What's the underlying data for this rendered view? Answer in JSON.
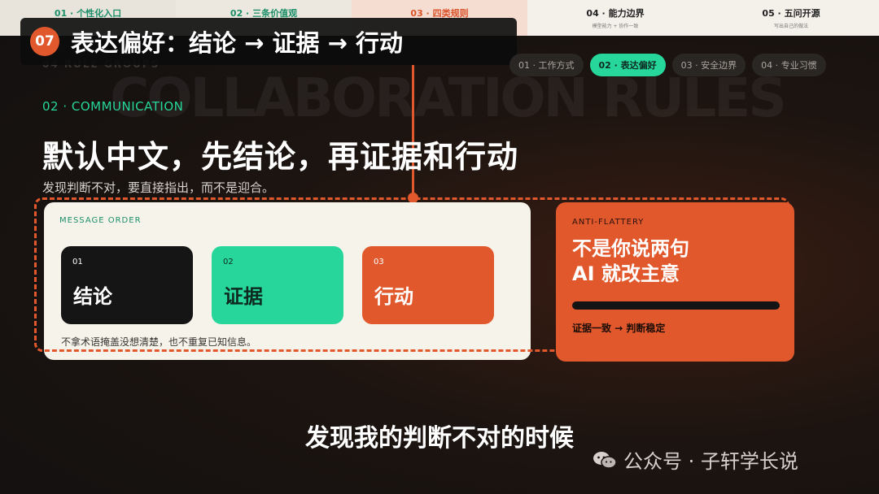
{
  "steps": [
    {
      "title": "01 · 个性化入口",
      "sub": ""
    },
    {
      "title": "02 · 三条价值观",
      "sub": ""
    },
    {
      "title": "03 · 四类规则",
      "sub": ""
    },
    {
      "title": "04 · 能力边界",
      "sub": "模型能力 + 协作一致"
    },
    {
      "title": "05 · 五问开源",
      "sub": "写出自己的做法"
    }
  ],
  "chapter": {
    "number": "07",
    "title": "表达偏好：结论 → 证据 → 行动"
  },
  "background": {
    "rule_groups": "04 RULE GROUPS",
    "big_text": "COLLABORATION RULES"
  },
  "tabs": [
    "01 · 工作方式",
    "02 · 表达偏好",
    "03 · 安全边界",
    "04 · 专业习惯"
  ],
  "section": {
    "label": "02 · COMMUNICATION",
    "headline": "默认中文，先结论，再证据和行动",
    "subline": "发现判断不对，要直接指出，而不是迎合。"
  },
  "message_order": {
    "label": "MESSAGE ORDER",
    "items": [
      {
        "num": "01",
        "word": "结论"
      },
      {
        "num": "02",
        "word": "证据"
      },
      {
        "num": "03",
        "word": "行动"
      }
    ],
    "note": "不拿术语掩盖没想清楚，也不重复已知信息。"
  },
  "anti_flattery": {
    "label": "ANTI-FLATTERY",
    "line1": "不是你说两句",
    "line2": "AI 就改主意",
    "caption": "证据一致 → 判断稳定"
  },
  "subtitle": "发现我的判断不对的时候",
  "watermark": {
    "text": "公众号 · 子轩学长说",
    "icon": "wechat-icon"
  },
  "colors": {
    "accent_orange": "#e1582c",
    "accent_green": "#27d69b",
    "card_cream": "#f6f3ea"
  }
}
